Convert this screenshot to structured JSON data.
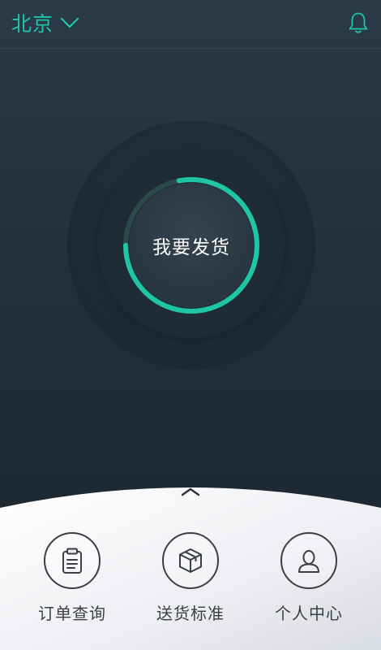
{
  "header": {
    "city": "北京",
    "chevron_icon": "chevron-down-icon",
    "bell_icon": "bell-icon",
    "accent_color": "#1fc6a6"
  },
  "main": {
    "ship_button_label": "我要发货",
    "ring_color": "#1fc6a6",
    "ring_progress": 0.78
  },
  "bottom_sheet": {
    "handle_icon": "chevron-up-icon",
    "actions": [
      {
        "label": "订单查询",
        "icon": "clipboard-icon"
      },
      {
        "label": "送货标准",
        "icon": "package-box-icon"
      },
      {
        "label": "个人中心",
        "icon": "user-icon"
      }
    ]
  }
}
